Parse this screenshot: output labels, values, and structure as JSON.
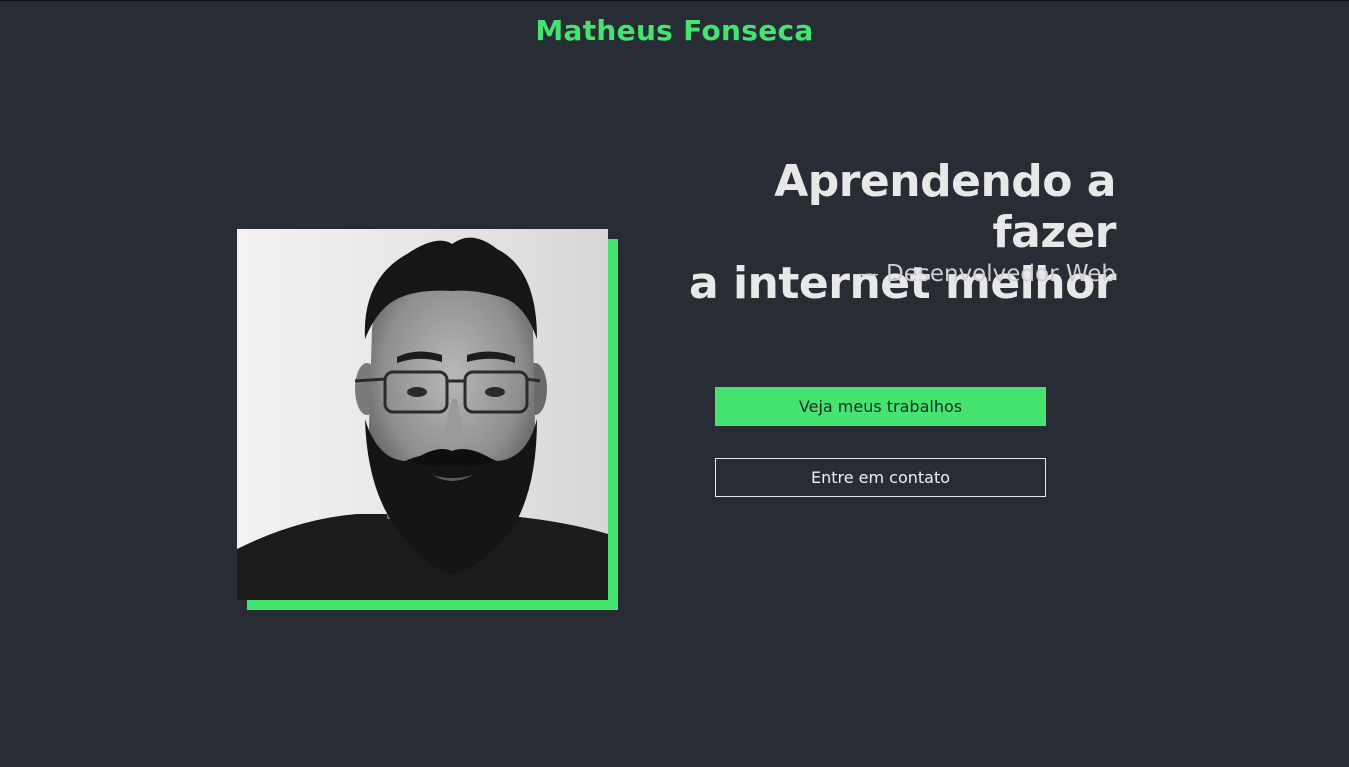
{
  "header": {
    "brand": "Matheus Fonseca"
  },
  "hero": {
    "headline_line1": "Aprendendo a fazer",
    "headline_line2": "a internet melhor",
    "subtitle": "— Desenvolvedor Web",
    "photo_alt": "Matheus Fonseca"
  },
  "actions": {
    "primary_label": "Veja meus trabalhos",
    "secondary_label": "Entre em contato"
  },
  "colors": {
    "background": "#272c35",
    "accent": "#45e36f",
    "text": "#e8e8e8"
  }
}
